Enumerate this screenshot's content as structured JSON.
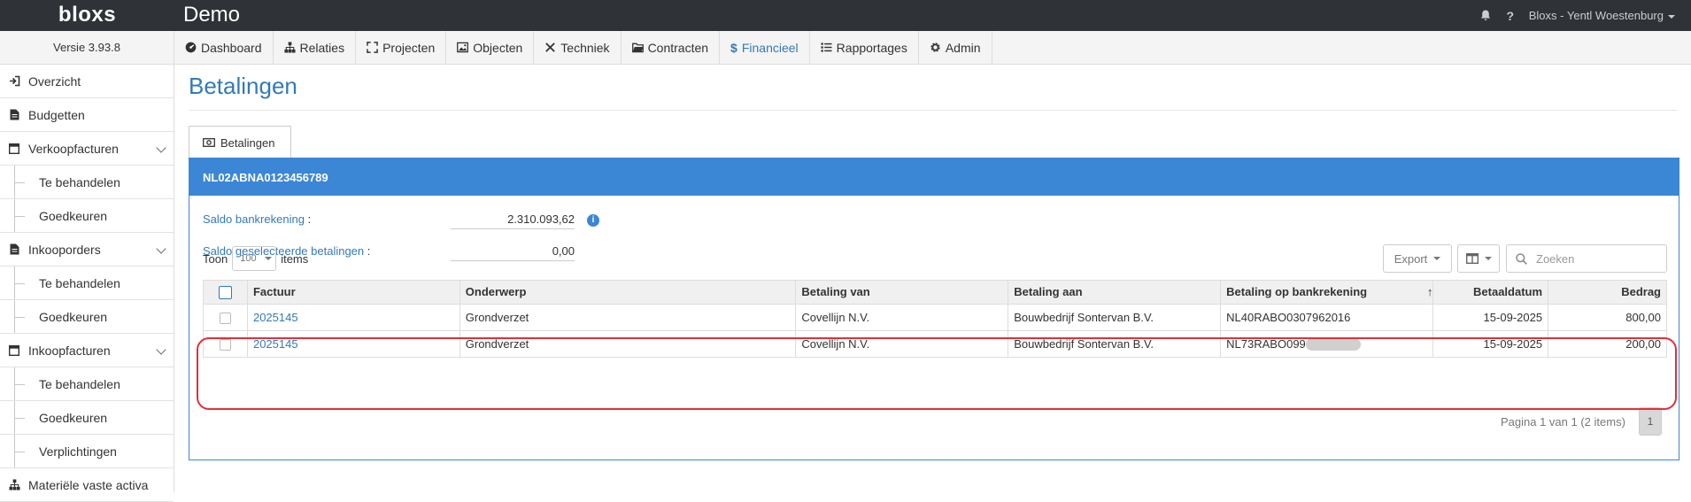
{
  "topbar": {
    "logo": "bloxs",
    "app_name": "Demo",
    "user": "Bloxs - Yentl Woestenburg",
    "bell_icon": "bell-icon",
    "help_icon": "?"
  },
  "version": "Versie 3.93.8",
  "nav": {
    "items": [
      {
        "label": "Dashboard",
        "icon": "dashboard-icon"
      },
      {
        "label": "Relaties",
        "icon": "sitemap-icon"
      },
      {
        "label": "Projecten",
        "icon": "expand-icon"
      },
      {
        "label": "Objecten",
        "icon": "image-icon"
      },
      {
        "label": "Techniek",
        "icon": "wrench-icon"
      },
      {
        "label": "Contracten",
        "icon": "folder-icon"
      },
      {
        "label": "Financieel",
        "icon": "dollar-icon",
        "active": true
      },
      {
        "label": "Rapportages",
        "icon": "list-icon"
      },
      {
        "label": "Admin",
        "icon": "gear-icon"
      }
    ]
  },
  "sidebar": {
    "items": [
      {
        "label": "Overzicht"
      },
      {
        "label": "Budgetten"
      },
      {
        "label": "Verkoopfacturen"
      },
      {
        "label": "Te behandelen"
      },
      {
        "label": "Goedkeuren"
      },
      {
        "label": "Inkooporders"
      },
      {
        "label": "Te behandelen"
      },
      {
        "label": "Goedkeuren"
      },
      {
        "label": "Inkoopfacturen"
      },
      {
        "label": "Te behandelen"
      },
      {
        "label": "Goedkeuren"
      },
      {
        "label": "Verplichtingen"
      },
      {
        "label": "Materiële vaste activa"
      }
    ]
  },
  "page": {
    "title": "Betalingen",
    "tab_label": "Betalingen",
    "account": "NL02ABNA0123456789",
    "saldo_bank_label": "Saldo bankrekening",
    "saldo_bank_value": "2.310.093,62",
    "saldo_sel_label": "Saldo geselecteerde betalingen",
    "saldo_sel_value": "0,00",
    "colon": ":",
    "toon_label": "Toon",
    "toon_value": "100",
    "items_label": "items",
    "export_label": "Export",
    "search_placeholder": "Zoeken"
  },
  "table": {
    "columns": [
      "Factuur",
      "Onderwerp",
      "Betaling van",
      "Betaling aan",
      "Betaling op bankrekening",
      "Betaaldatum",
      "Bedrag"
    ],
    "rows": [
      {
        "factuur": "2025145",
        "onderwerp": "Grondverzet",
        "van": "Covellijn N.V.",
        "aan": "Bouwbedrijf Sontervan B.V.",
        "rekening": "NL40RABO0307962016",
        "datum": "15-09-2025",
        "bedrag": "800,00"
      },
      {
        "factuur": "2025145",
        "onderwerp": "Grondverzet",
        "van": "Covellijn N.V.",
        "aan": "Bouwbedrijf Sontervan B.V.",
        "rekening": "NL73RABO099",
        "datum": "15-09-2025",
        "bedrag": "200,00"
      }
    ]
  },
  "pager": {
    "info": "Pagina 1 van 1 (2 items)",
    "page": "1"
  },
  "colors": {
    "topbar": "#2f3237",
    "accent": "#337ab7",
    "panel": "#3c86d6",
    "highlight": "#e0303a"
  }
}
